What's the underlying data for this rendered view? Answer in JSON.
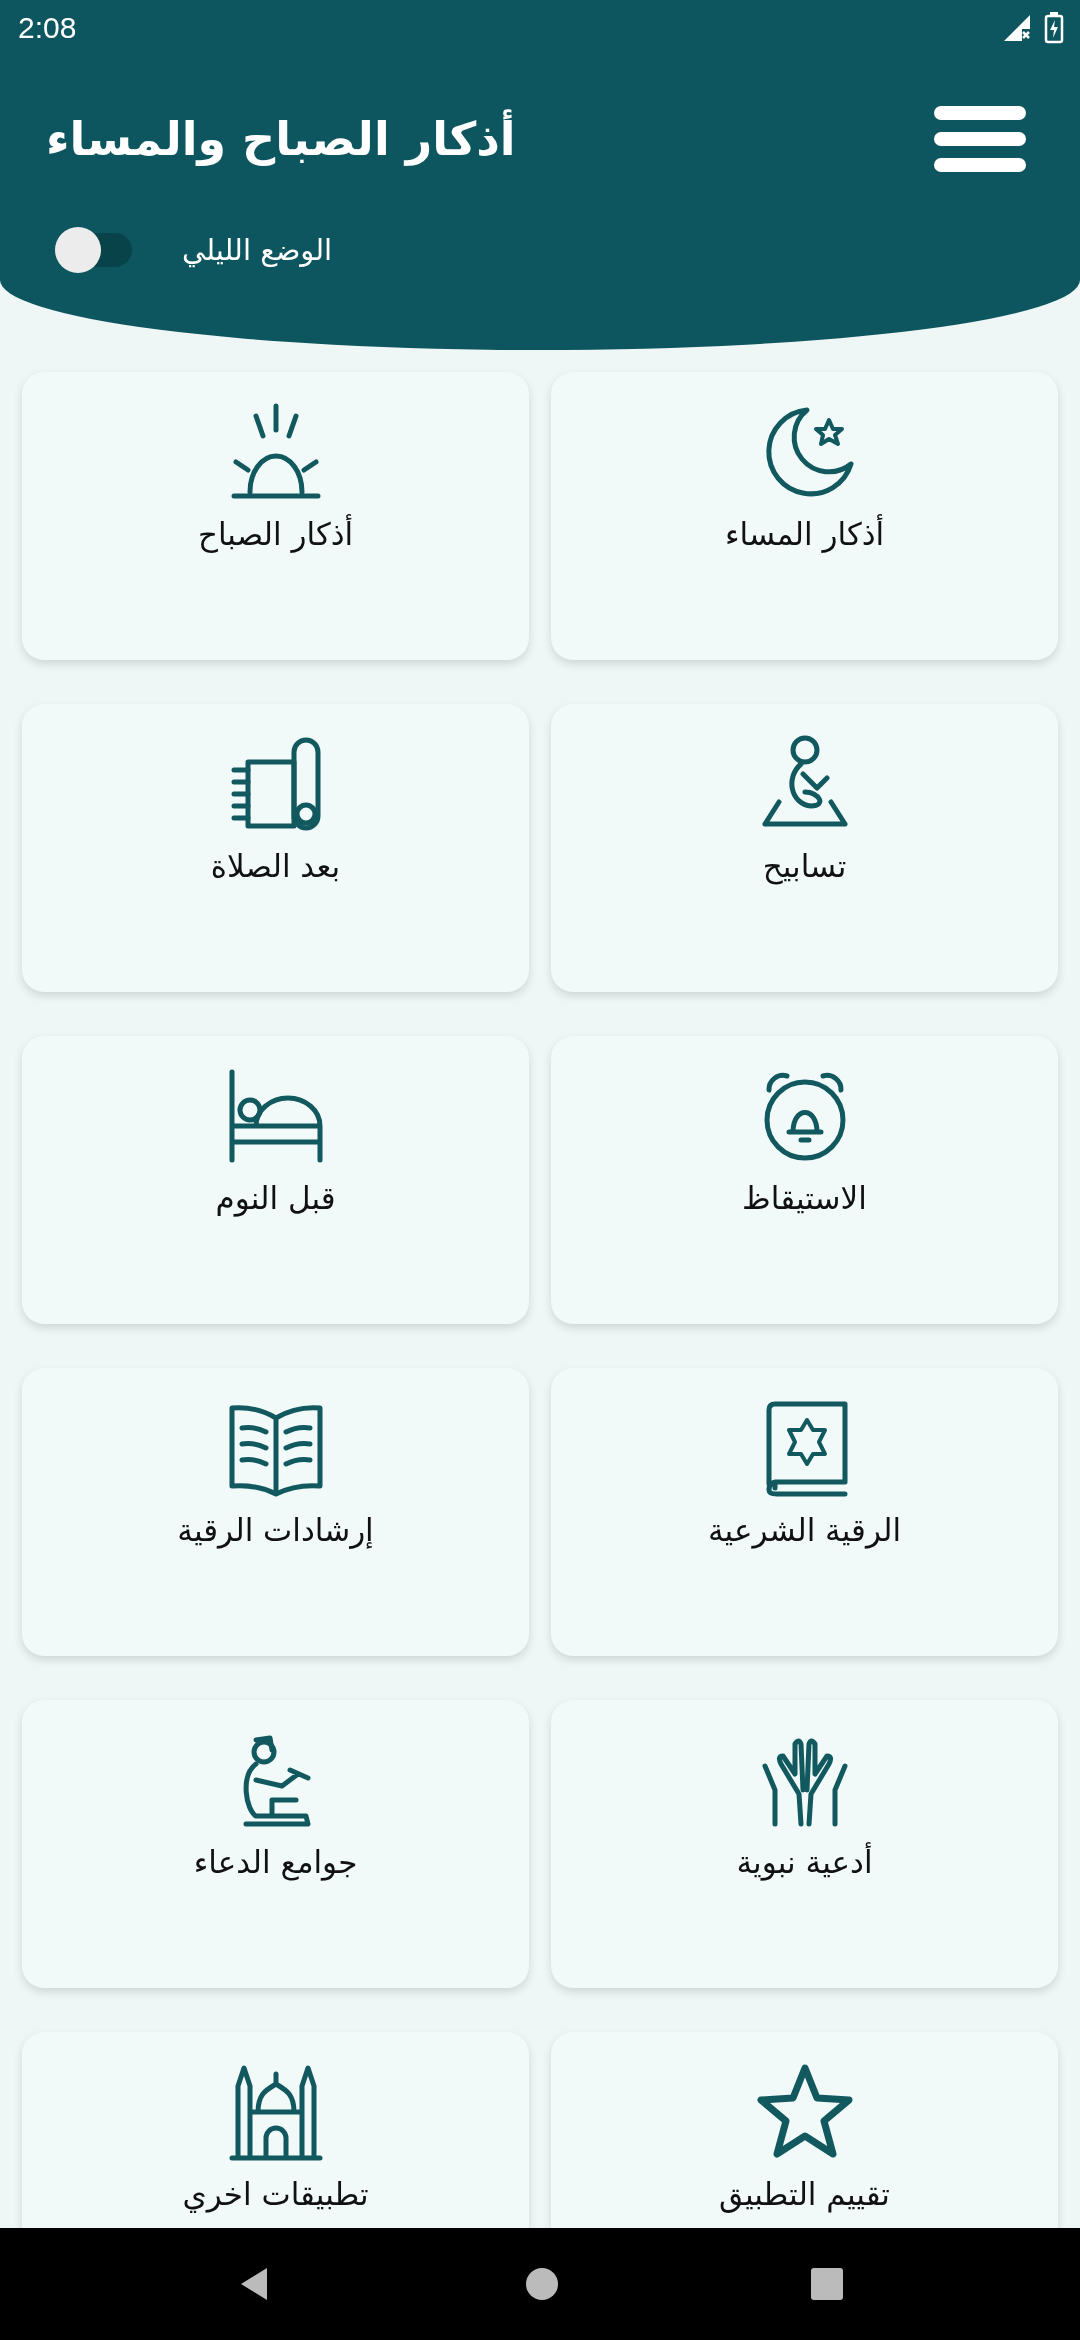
{
  "status_bar": {
    "time": "2:08"
  },
  "header": {
    "title": "أذكار الصباح والمساء",
    "night_mode": {
      "label": "الوضع الليلي",
      "on": false
    }
  },
  "cards": [
    {
      "label": "أذكار المساء",
      "kind": "crescent"
    },
    {
      "label": "أذكار الصباح",
      "kind": "sunrise"
    },
    {
      "label": "تسابيح",
      "kind": "prayer"
    },
    {
      "label": "بعد الصلاة",
      "kind": "mat"
    },
    {
      "label": "الاستيقاظ",
      "kind": "alarm"
    },
    {
      "label": "قبل النوم",
      "kind": "bed"
    },
    {
      "label": "الرقية الشرعية",
      "kind": "quran"
    },
    {
      "label": "إرشادات الرقية",
      "kind": "book"
    },
    {
      "label": "أدعية نبوية",
      "kind": "hands"
    },
    {
      "label": "جوامع الدعاء",
      "kind": "dua"
    },
    {
      "label": "تقييم التطبيق",
      "kind": "star"
    },
    {
      "label": "تطبيقات اخري",
      "kind": "mosque"
    }
  ]
}
